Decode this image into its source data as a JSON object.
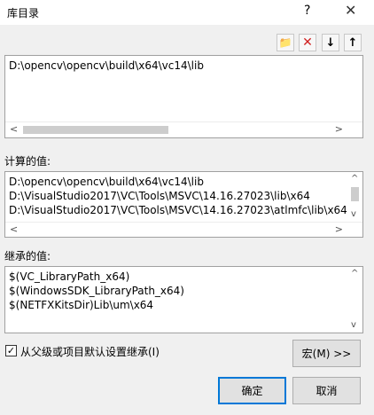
{
  "dialog": {
    "title": "库目录",
    "help": "?",
    "close": "✕"
  },
  "toolbar": {
    "new_folder": "📁",
    "delete": "✕",
    "move_down": "↓",
    "move_up": "↑"
  },
  "edit": {
    "value": "D:\\opencv\\opencv\\build\\x64\\vc14\\lib"
  },
  "computed": {
    "label": "计算的值:",
    "lines": [
      "D:\\opencv\\opencv\\build\\x64\\vc14\\lib",
      "D:\\VisualStudio2017\\VC\\Tools\\MSVC\\14.16.27023\\lib\\x64",
      "D:\\VisualStudio2017\\VC\\Tools\\MSVC\\14.16.27023\\atlmfc\\lib\\x64"
    ]
  },
  "inherited": {
    "label": "继承的值:",
    "lines": [
      "$(VC_LibraryPath_x64)",
      "$(WindowsSDK_LibraryPath_x64)",
      "$(NETFXKitsDir)Lib\\um\\x64"
    ]
  },
  "inherit_checkbox": {
    "label": "从父级或项目默认设置继承(I)",
    "checked_mark": "✓"
  },
  "buttons": {
    "macros": "宏(M) >>",
    "ok": "确定",
    "cancel": "取消"
  },
  "scroll": {
    "left": "<",
    "right": ">",
    "up": "^",
    "down": "v"
  }
}
